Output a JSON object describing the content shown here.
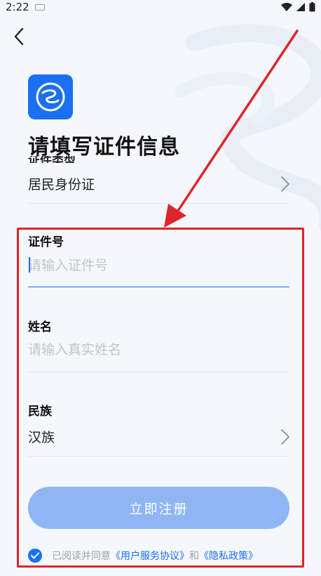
{
  "status_bar": {
    "time": "2:22"
  },
  "page": {
    "title": "请填写证件信息"
  },
  "doc_type": {
    "partial_label": "证件类型",
    "value": "居民身份证"
  },
  "id_number": {
    "label": "证件号",
    "placeholder": "请输入证件号"
  },
  "name": {
    "label": "姓名",
    "placeholder": "请输入真实姓名"
  },
  "ethnicity": {
    "label": "民族",
    "value": "汉族"
  },
  "submit_label": "立即注册",
  "agreement": {
    "prefix": "已阅读并同意",
    "terms_link": "《用户服务协议》",
    "conjunction": "和",
    "privacy_link": "《隐私政策》",
    "checked": true
  },
  "colors": {
    "accent": "#1a6ff2",
    "button_disabled": "#8fb6f3",
    "annotation": "#e0232b"
  }
}
